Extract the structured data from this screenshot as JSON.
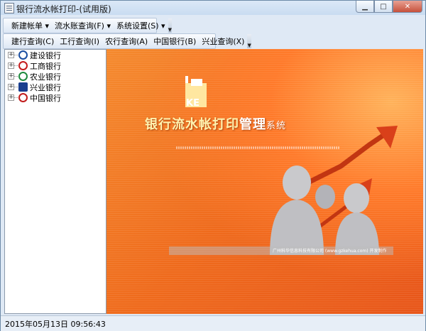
{
  "window": {
    "title": "银行流水帐打印-(试用版)",
    "min_icon": "minimize-icon",
    "max_icon": "maximize-icon",
    "close_icon": "close-icon"
  },
  "menubar": {
    "items": [
      "新建帐单 ▾",
      "流水账查询(F) ▾",
      "系统设置(S) ▾"
    ]
  },
  "toolbar": {
    "items": [
      "建行查询(C)",
      "工行查询(I)",
      "农行查询(A)",
      "中国银行(B)",
      "兴业查询(X)"
    ]
  },
  "tree": {
    "items": [
      {
        "label": "建设银行",
        "icon": "ccb-logo-icon"
      },
      {
        "label": "工商银行",
        "icon": "icbc-logo-icon"
      },
      {
        "label": "农业银行",
        "icon": "abc-logo-icon"
      },
      {
        "label": "兴业银行",
        "icon": "cib-logo-icon"
      },
      {
        "label": "中国银行",
        "icon": "boc-logo-icon"
      }
    ]
  },
  "splash": {
    "logo_text": "KE",
    "title_a": "银行流水帐打印",
    "title_b": "管理",
    "title_c": "系统",
    "company": "广州科华信息科技有限公司 (www.gzkehua.com) 开发制作"
  },
  "statusbar": {
    "datetime": "2015年05月13日 09:56:43"
  },
  "colors": {
    "accent": "#ef6a1c",
    "title_text": "#fff3b0"
  }
}
